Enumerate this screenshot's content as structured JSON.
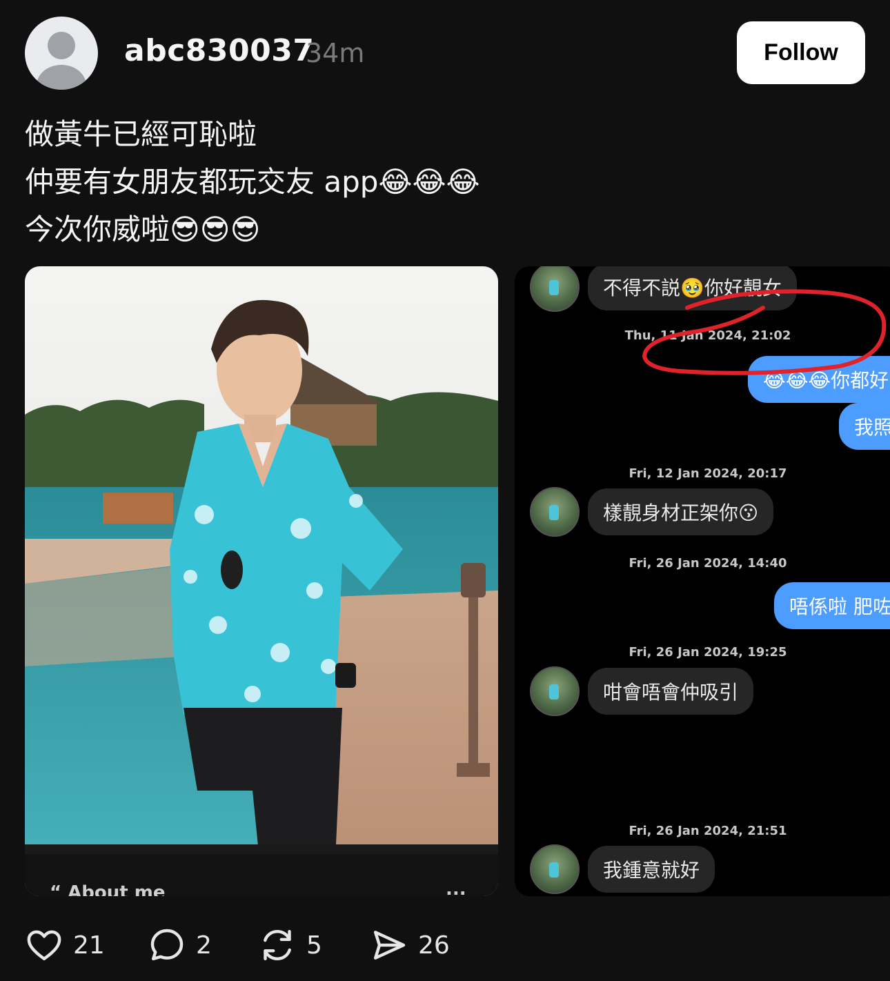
{
  "header": {
    "username": "abc830037",
    "time_ago": "34m",
    "follow_label": "Follow"
  },
  "caption": {
    "lines": [
      "做黃牛已經可恥啦",
      "仲要有女朋友都玩交友 app😂😂😂",
      "今次你威啦😎😎😎"
    ]
  },
  "media": {
    "photo_overlay_label": "“ About me",
    "photo_overlay_more": "...",
    "chat": {
      "messages": [
        {
          "type": "in",
          "text": "不得不説🥹你好靚女"
        },
        {
          "type": "date",
          "text": "Thu, 11 Jan 2024, 21:02"
        },
        {
          "type": "out",
          "text": "😂😂😂你都好"
        },
        {
          "type": "out",
          "text": "我照"
        },
        {
          "type": "date",
          "text": "Fri, 12 Jan 2024, 20:17"
        },
        {
          "type": "in",
          "text": "樣靚身材正架你😗"
        },
        {
          "type": "date",
          "text": "Fri, 26 Jan 2024, 14:40"
        },
        {
          "type": "out",
          "text": "唔係啦 肥咗"
        },
        {
          "type": "date",
          "text": "Fri, 26 Jan 2024, 19:25"
        },
        {
          "type": "in",
          "text": "咁會唔會仲吸引"
        },
        {
          "type": "date",
          "text": "Fri, 26 Jan 2024, 21:51"
        },
        {
          "type": "in",
          "text": "我鍾意就好"
        }
      ]
    }
  },
  "actions": {
    "likes": "21",
    "replies": "2",
    "reposts": "5",
    "shares": "26"
  },
  "colors": {
    "background": "#101010",
    "outgoing_bubble": "#4c9dff",
    "incoming_bubble": "#262626",
    "annotation_circle": "#e0232b"
  }
}
